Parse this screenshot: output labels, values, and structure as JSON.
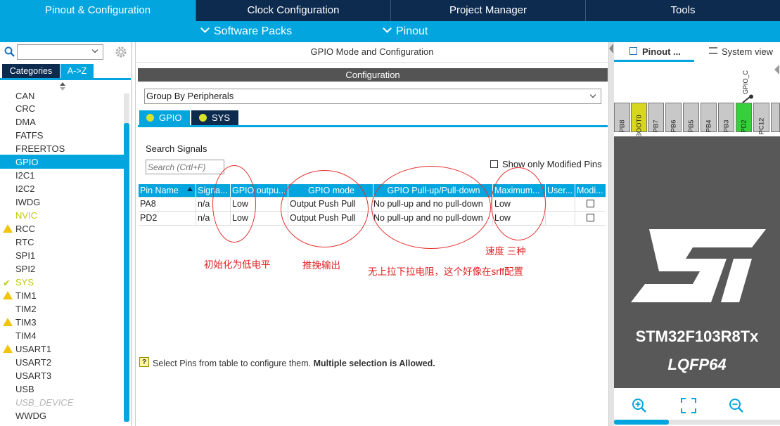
{
  "top_tabs": [
    "Pinout & Configuration",
    "Clock Configuration",
    "Project Manager",
    "Tools"
  ],
  "sub_menu": {
    "software_packs": "Software Packs",
    "pinout": "Pinout"
  },
  "left": {
    "tab_categories": "Categories",
    "tab_az": "A->Z",
    "items": [
      "CAN",
      "CRC",
      "DMA",
      "FATFS",
      "FREERTOS",
      "GPIO",
      "I2C1",
      "I2C2",
      "IWDG",
      "NVIC",
      "RCC",
      "RTC",
      "SPI1",
      "SPI2",
      "SYS",
      "TIM1",
      "TIM2",
      "TIM3",
      "TIM4",
      "USART1",
      "USART2",
      "USART3",
      "USB",
      "USB_DEVICE",
      "WWDG"
    ]
  },
  "center": {
    "title": "GPIO Mode and Configuration",
    "config_header": "Configuration",
    "group_by": "Group By Peripherals",
    "tab_gpio": "GPIO",
    "tab_sys": "SYS",
    "search_label": "Search Signals",
    "search_placeholder": "Search (Crtl+F)",
    "show_modified": "Show only Modified Pins",
    "columns": [
      "Pin Name",
      "Signa...",
      "GPIO outpu...",
      "GPIO mode",
      "GPIO Pull-up/Pull-down",
      "Maximum...",
      "User...",
      "Modi..."
    ],
    "rows": [
      [
        "PA8",
        "n/a",
        "Low",
        "Output Push Pull",
        "No pull-up and no pull-down",
        "Low"
      ],
      [
        "PD2",
        "n/a",
        "Low",
        "Output Push Pull",
        "No pull-up and no pull-down",
        "Low"
      ]
    ],
    "annotations": [
      "初始化为低电平",
      "推挽输出",
      "无上拉下拉电阻，这个好像在srff配置",
      "速度 三种"
    ],
    "hint_text": "Select Pins from table to configure them. ",
    "hint_bold": "Multiple selection is Allowed."
  },
  "right": {
    "tab_pinout": "Pinout ...",
    "tab_system": "System view",
    "top_label": "GPIO_C",
    "pins": [
      "PB8",
      "BOOT0",
      "PB7",
      "PB6",
      "PB5",
      "PB4",
      "PB3",
      "PD2",
      "PC12"
    ],
    "chip_name": "STM32F103R8Tx",
    "chip_pkg": "LQFP64"
  }
}
